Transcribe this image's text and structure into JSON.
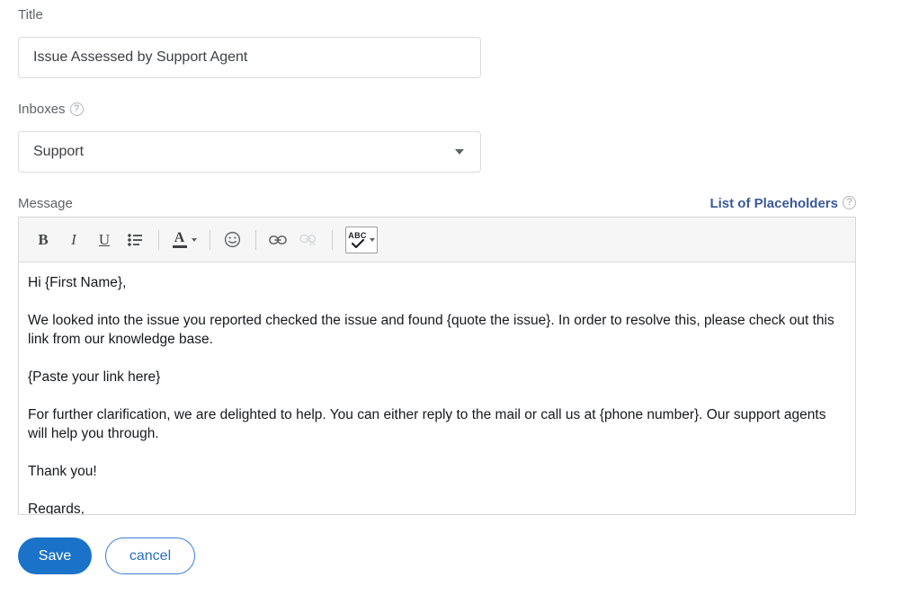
{
  "form": {
    "title": {
      "label": "Title",
      "value": "Issue Assessed by Support Agent",
      "placeholder": "Title"
    },
    "inboxes": {
      "label": "Inboxes",
      "help": "?",
      "selected": "Support",
      "options": [
        "Support"
      ]
    },
    "message": {
      "label": "Message",
      "placeholders_link": "List of Placeholders",
      "placeholders_help": "?"
    }
  },
  "toolbar": {
    "bold": "B",
    "italic": "I",
    "underline": "U",
    "bullet_list": "•≡",
    "font_color": "A",
    "emoji": "☺",
    "link": "⚭",
    "unlink": "⚭",
    "spellcheck": "ABC"
  },
  "body": {
    "paragraphs": [
      "Hi {First Name},",
      "We looked into the issue you reported checked the issue and found {quote the issue}. In order to resolve this, please check out this link from our knowledge base.",
      "{Paste your link here}",
      "For further clarification, we are delighted to help. You can either reply to the mail or call us at {phone number}. Our support agents will help you through.",
      "Thank you!",
      "Regards,"
    ]
  },
  "footer": {
    "save_label": "Save",
    "cancel_label": "cancel"
  },
  "colors": {
    "accent": "#1a73c8",
    "link": "#3b5998",
    "label": "#5f6368",
    "border": "#dcdcdc",
    "toolbar_bg": "#f6f6f6"
  }
}
